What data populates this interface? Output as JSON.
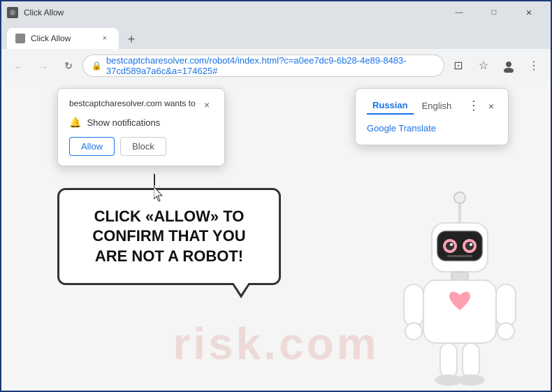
{
  "titlebar": {
    "title": "Click Allow",
    "favicon_label": "favicon"
  },
  "tabbar": {
    "tab_title": "Click Allow",
    "new_tab_symbol": "+"
  },
  "addressbar": {
    "back_symbol": "←",
    "forward_symbol": "→",
    "reload_symbol": "↻",
    "url": "bestcaptcharesolver.com/robot4/index.html?c=a0ee7dc9-6b28-4e89-8483-37cd589a7a6c&a=174625#",
    "lock_symbol": "🔒",
    "star_symbol": "☆",
    "account_symbol": "⊙",
    "menu_symbol": "⋮",
    "cast_symbol": "⊡"
  },
  "notification_popup": {
    "site_text": "bestcaptcharesolver.com wants to",
    "notification_label": "Show notifications",
    "allow_btn": "Allow",
    "block_btn": "Block",
    "close_symbol": "×",
    "bell_symbol": "🔔"
  },
  "translate_popup": {
    "lang1": "Russian",
    "lang2": "English",
    "translate_service": "Google Translate",
    "more_symbol": "⋮",
    "close_symbol": "×"
  },
  "webpage": {
    "bubble_line1": "CLICK «ALLOW» TO CONFIRM THAT YOU",
    "bubble_line2": "ARE NOT A ROBOT!",
    "watermark": "risk.com"
  },
  "window_controls": {
    "minimize": "—",
    "maximize": "□",
    "close": "✕"
  }
}
